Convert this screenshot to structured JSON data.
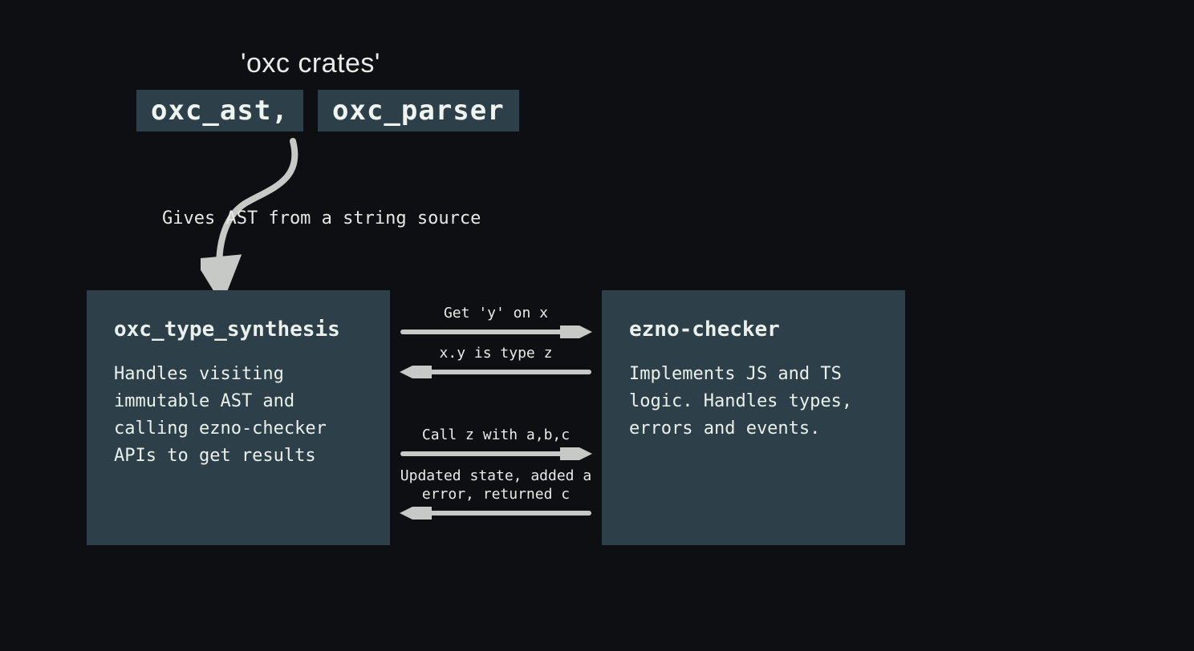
{
  "top": {
    "title": "'oxc crates'",
    "badge1": "oxc_ast,",
    "badge2": "oxc_parser"
  },
  "down_arrow_caption": "Gives AST from a string source",
  "left_box": {
    "title": "oxc_type_synthesis",
    "body": "Handles visiting immutable AST and calling ezno-checker APIs to get results"
  },
  "right_box": {
    "title": "ezno-checker",
    "body": "Implements JS and TS logic. Handles types, errors and events."
  },
  "arrows": {
    "a1": "Get 'y' on x",
    "a2": "x.y is type z",
    "a3": "Call z with a,b,c",
    "a4": "Updated state, added a error, returned c"
  }
}
